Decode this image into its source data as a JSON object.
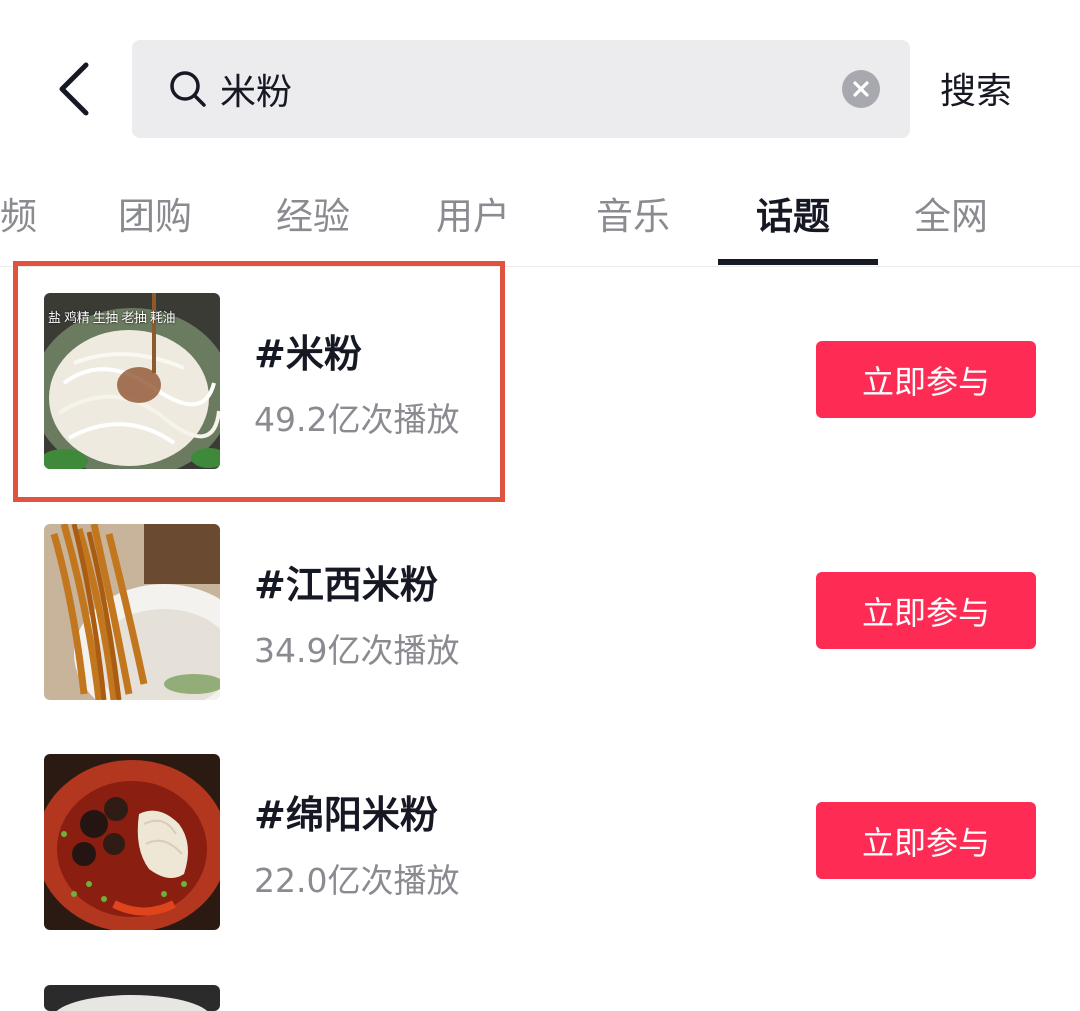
{
  "header": {
    "back_icon": "chevron-left-icon",
    "search": {
      "value": "米粉",
      "placeholder": ""
    },
    "search_button_label": "搜索"
  },
  "tabs": [
    {
      "label": "频",
      "active": false
    },
    {
      "label": "团购",
      "active": false
    },
    {
      "label": "经验",
      "active": false
    },
    {
      "label": "用户",
      "active": false
    },
    {
      "label": "音乐",
      "active": false
    },
    {
      "label": "话题",
      "active": true
    },
    {
      "label": "全网",
      "active": false
    }
  ],
  "topics": [
    {
      "title": "#米粉",
      "plays": "49.2亿次播放",
      "join_label": "立即参与",
      "thumb_caption": "盐 鸡精 生抽 老抽 耗油",
      "highlighted": true
    },
    {
      "title": "#江西米粉",
      "plays": "34.9亿次播放",
      "join_label": "立即参与"
    },
    {
      "title": "#绵阳米粉",
      "plays": "22.0亿次播放",
      "join_label": "立即参与"
    }
  ],
  "colors": {
    "accent": "#fe2c55",
    "highlight_border": "#e0533f",
    "search_bg": "#ececee"
  }
}
